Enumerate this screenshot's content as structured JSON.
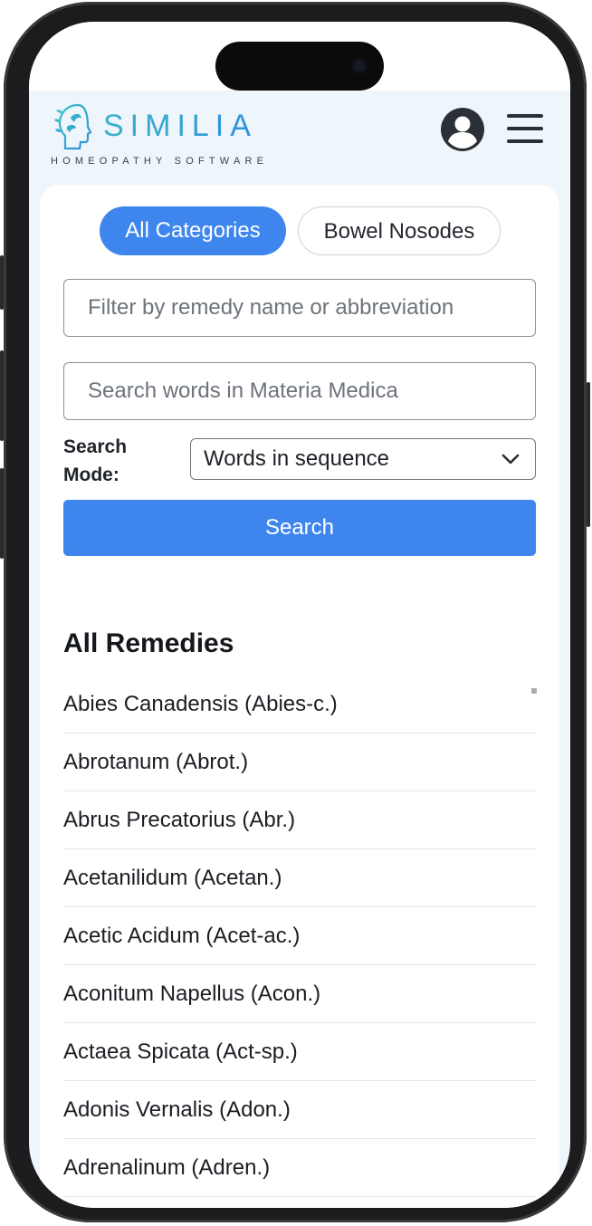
{
  "header": {
    "logo_name": "SIMILIA",
    "logo_tagline": "HOMEOPATHY SOFTWARE",
    "user_icon": "user-circle-icon",
    "menu_icon": "hamburger-menu-icon"
  },
  "colors": {
    "accent": "#3e86ee",
    "logo_gradient_start": "#3bb3c9",
    "logo_gradient_end": "#2b8fe0",
    "header_background": "#eef5fb"
  },
  "categories": {
    "active": "All Categories",
    "inactive": "Bowel Nosodes"
  },
  "filters": {
    "remedy_filter_placeholder": "Filter by remedy name or abbreviation",
    "remedy_filter_value": "",
    "materia_search_placeholder": "Search words in Materia Medica",
    "materia_search_value": ""
  },
  "search_mode": {
    "label": "Search Mode:",
    "selected": "Words in sequence",
    "chevron_icon": "chevron-down-icon"
  },
  "search_button_label": "Search",
  "remedies": {
    "title": "All Remedies",
    "items": [
      "Abies Canadensis (Abies-c.)",
      "Abrotanum (Abrot.)",
      "Abrus Precatorius (Abr.)",
      "Acetanilidum (Acetan.)",
      "Acetic Acidum (Acet-ac.)",
      "Aconitum Napellus (Acon.)",
      "Actaea Spicata (Act-sp.)",
      "Adonis Vernalis (Adon.)",
      "Adrenalinum (Adren.)"
    ]
  }
}
